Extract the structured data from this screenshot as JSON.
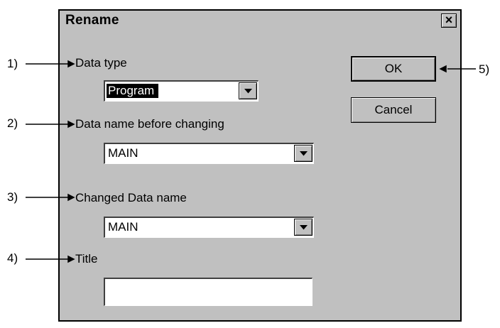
{
  "dialog": {
    "title": "Rename"
  },
  "fields": {
    "data_type": {
      "label": "Data type",
      "value": "Program"
    },
    "name_before": {
      "label": "Data name before changing",
      "value": "MAIN"
    },
    "name_changed": {
      "label": "Changed Data name",
      "value": "MAIN"
    },
    "title": {
      "label": "Title",
      "value": ""
    }
  },
  "buttons": {
    "ok": "OK",
    "cancel": "Cancel"
  },
  "callouts": [
    "1)",
    "2)",
    "3)",
    "4)",
    "5)"
  ],
  "icons": {
    "close": "close-icon",
    "dropdown": "chevron-down-icon"
  }
}
